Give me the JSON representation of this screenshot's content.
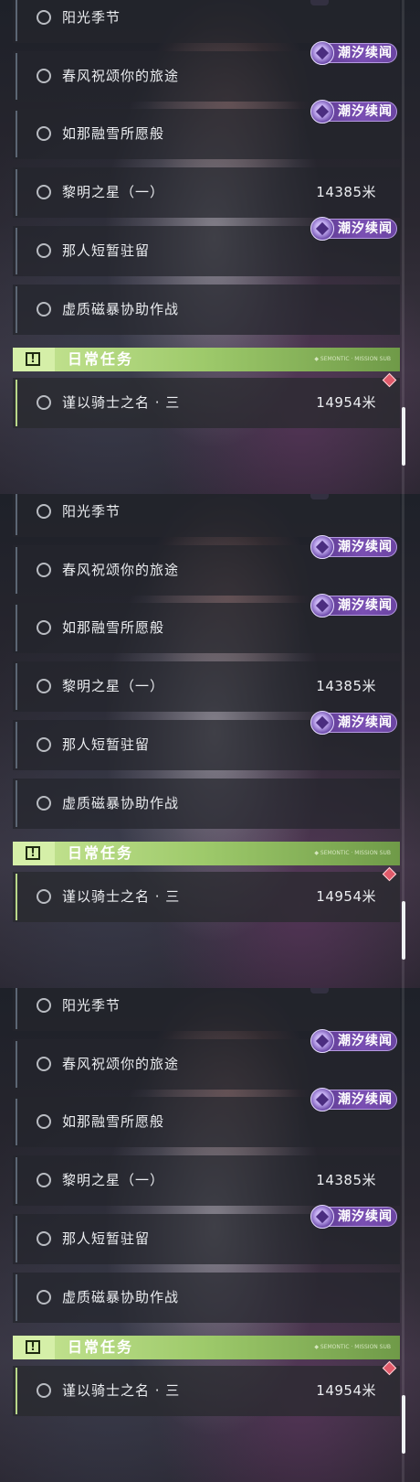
{
  "panels": [
    {
      "quests": [
        {
          "label": "阳光季节",
          "distance": "",
          "badge": ""
        },
        {
          "label": "春风祝颂你的旅途",
          "distance": "",
          "badge": "潮汐续闻"
        },
        {
          "label": "如那融雪所愿般",
          "distance": "",
          "badge": "潮汐续闻"
        },
        {
          "label": "黎明之星（一）",
          "distance": "14385米",
          "badge": ""
        },
        {
          "label": "那人短暂驻留",
          "distance": "",
          "badge": "潮汐续闻"
        },
        {
          "label": "虚质磁暴协助作战",
          "distance": "",
          "badge": ""
        }
      ],
      "section": {
        "title": "日常任务",
        "deco_text": "◆ SEMONTIC · MISSION SUB"
      },
      "daily": {
        "label": "谨以骑士之名 · 三",
        "distance": "14954米"
      }
    },
    {
      "quests": [
        {
          "label": "阳光季节",
          "distance": "",
          "badge": ""
        },
        {
          "label": "春风祝颂你的旅途",
          "distance": "",
          "badge": "潮汐续闻"
        },
        {
          "label": "如那融雪所愿般",
          "distance": "",
          "badge": "潮汐续闻"
        },
        {
          "label": "黎明之星（一）",
          "distance": "14385米",
          "badge": ""
        },
        {
          "label": "那人短暂驻留",
          "distance": "",
          "badge": "潮汐续闻"
        },
        {
          "label": "虚质磁暴协助作战",
          "distance": "",
          "badge": ""
        }
      ],
      "section": {
        "title": "日常任务",
        "deco_text": "◆ SEMONTIC · MISSION SUB"
      },
      "daily": {
        "label": "谨以骑士之名 · 三",
        "distance": "14954米"
      }
    },
    {
      "quests": [
        {
          "label": "阳光季节",
          "distance": "",
          "badge": ""
        },
        {
          "label": "春风祝颂你的旅途",
          "distance": "",
          "badge": "潮汐续闻"
        },
        {
          "label": "如那融雪所愿般",
          "distance": "",
          "badge": "潮汐续闻"
        },
        {
          "label": "黎明之星（一）",
          "distance": "14385米",
          "badge": ""
        },
        {
          "label": "那人短暂驻留",
          "distance": "",
          "badge": "潮汐续闻"
        },
        {
          "label": "虚质磁暴协助作战",
          "distance": "",
          "badge": ""
        }
      ],
      "section": {
        "title": "日常任务",
        "deco_text": "◆ SEMONTIC · MISSION SUB"
      },
      "daily": {
        "label": "谨以骑士之名 · 三",
        "distance": "14954米"
      }
    }
  ]
}
